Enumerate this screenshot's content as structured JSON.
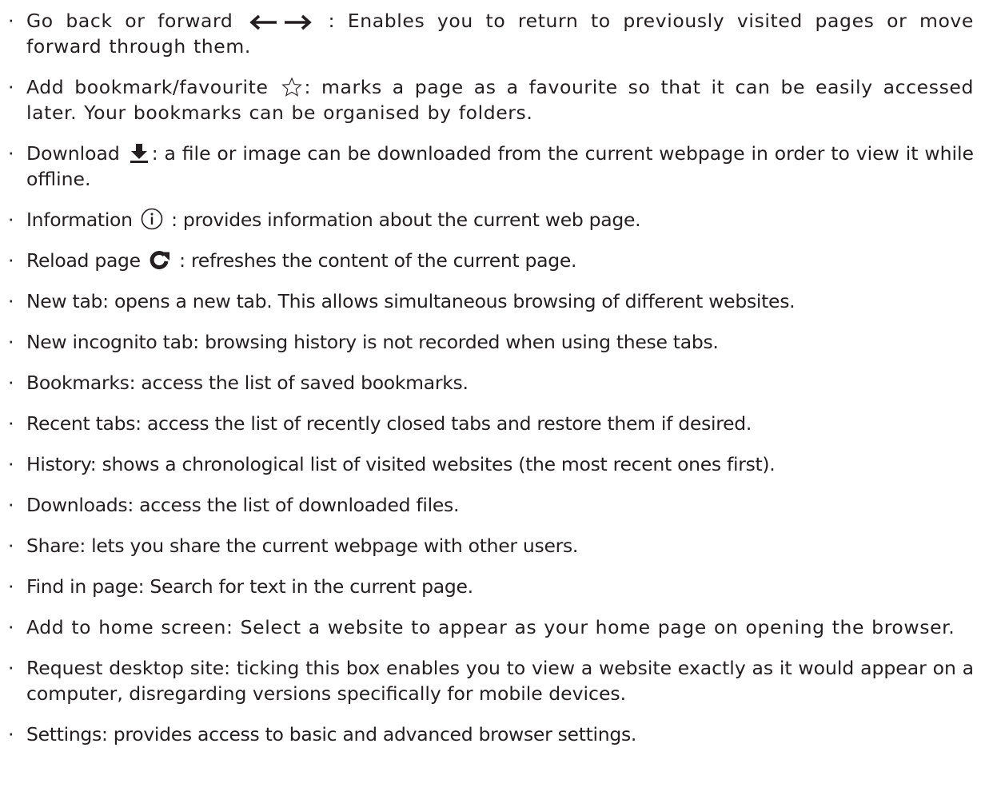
{
  "bullet": "·",
  "items": [
    {
      "before": "Go back or forward",
      "icons": [
        "arrow-left-icon",
        "arrow-right-icon"
      ],
      "after": " : Enables you to return to previously visited pages or move forward through them."
    },
    {
      "before": "Add bookmark/favourite",
      "icons": [
        "star-outline-icon"
      ],
      "after": ": marks a page as a favourite so that it can be easily accessed later. Your bookmarks can be organised by folders."
    },
    {
      "before": "Download",
      "icons": [
        "download-icon"
      ],
      "after": ": a file or image can be downloaded from the current webpage in order to view it while offline."
    },
    {
      "before": "Information",
      "icons": [
        "info-circle-icon"
      ],
      "after": " : provides information about the current web page."
    },
    {
      "before": "Reload page",
      "icons": [
        "reload-icon"
      ],
      "after": " : refreshes the content of the current page."
    },
    {
      "text": "New tab: opens a new tab. This allows simultaneous browsing of different websites."
    },
    {
      "text": "New incognito tab: browsing history is not recorded when using these tabs."
    },
    {
      "text": "Bookmarks: access the list of saved bookmarks."
    },
    {
      "text": "Recent tabs: access the list of recently closed tabs and restore them if desired."
    },
    {
      "text": "History: shows a chronological list of visited websites (the most recent ones first)."
    },
    {
      "text": "Downloads: access the list of downloaded files."
    },
    {
      "text": "Share: lets you share the current webpage with other users."
    },
    {
      "text": "Find in page: Search for text in the current page."
    },
    {
      "text": "Add to home screen: Select a website to appear as your home page on opening the browser."
    },
    {
      "text": "Request desktop site: ticking this box enables you to view a website exactly as it would appear on a computer, disregarding versions specifically for mobile devices."
    },
    {
      "text": "Settings: provides access to basic and advanced browser settings."
    }
  ]
}
